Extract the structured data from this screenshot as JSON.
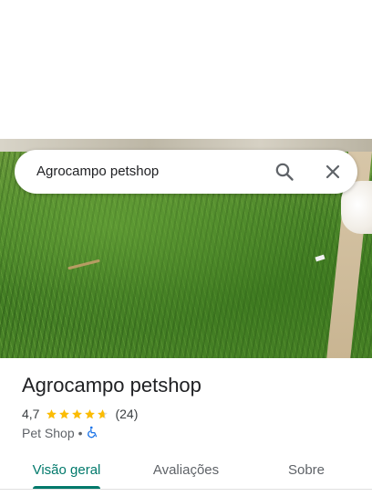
{
  "search": {
    "query": "Agrocampo petshop",
    "search_icon": "search-icon",
    "close_icon": "close-icon"
  },
  "place": {
    "name": "Agrocampo petshop",
    "rating": "4,7",
    "rating_value": 4.7,
    "review_count": "(24)",
    "category": "Pet Shop",
    "separator": "•",
    "accessibility_icon": "wheelchair-icon",
    "star_color": "#fbbc04",
    "accessibility_color": "#1a73e8"
  },
  "tabs": [
    {
      "label": "Visão geral",
      "active": true
    },
    {
      "label": "Avaliações",
      "active": false
    },
    {
      "label": "Sobre",
      "active": false
    }
  ],
  "colors": {
    "accent": "#00796b",
    "text_primary": "#202124",
    "text_secondary": "#5f6368"
  }
}
